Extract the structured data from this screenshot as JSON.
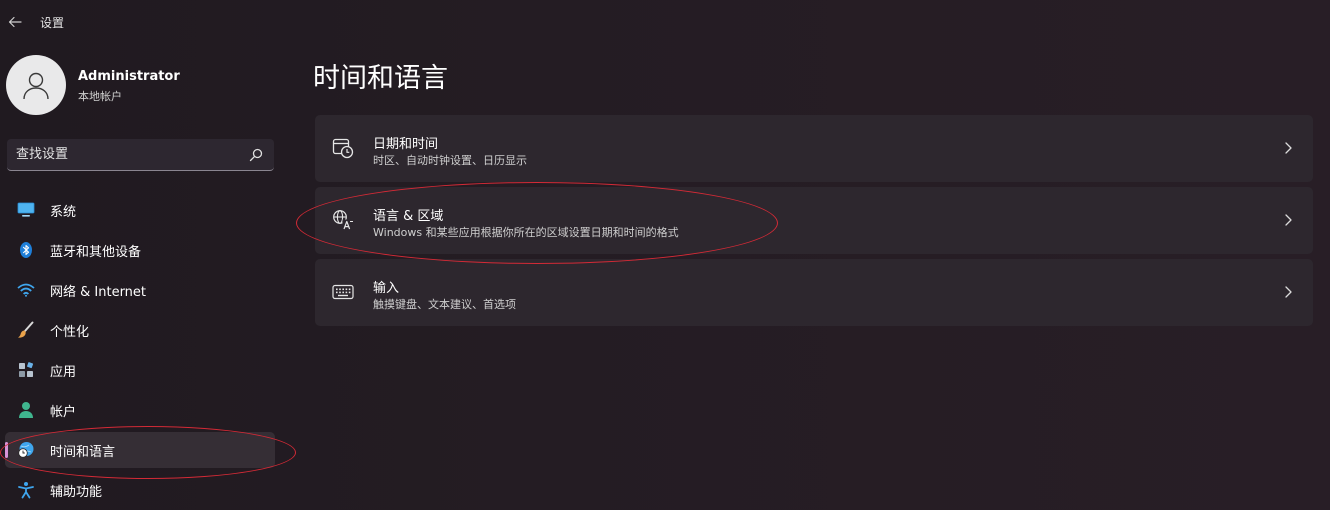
{
  "window": {
    "title": "设置"
  },
  "profile": {
    "name": "Administrator",
    "account_type": "本地帐户"
  },
  "search": {
    "placeholder": "查找设置",
    "value": ""
  },
  "sidebar": {
    "items": [
      {
        "label": "系统",
        "icon": "monitor-icon",
        "active": false
      },
      {
        "label": "蓝牙和其他设备",
        "icon": "bluetooth-icon",
        "active": false
      },
      {
        "label": "网络 & Internet",
        "icon": "wifi-icon",
        "active": false
      },
      {
        "label": "个性化",
        "icon": "brush-icon",
        "active": false
      },
      {
        "label": "应用",
        "icon": "apps-icon",
        "active": false
      },
      {
        "label": "帐户",
        "icon": "person-icon",
        "active": false
      },
      {
        "label": "时间和语言",
        "icon": "globe-clock-icon",
        "active": true
      },
      {
        "label": "辅助功能",
        "icon": "accessibility-icon",
        "active": false
      }
    ]
  },
  "main": {
    "title": "时间和语言",
    "cards": [
      {
        "title": "日期和时间",
        "subtitle": "时区、自动时钟设置、日历显示",
        "icon": "calendar-clock-icon"
      },
      {
        "title": "语言 & 区域",
        "subtitle": "Windows 和某些应用根据你所在的区域设置日期和时间的格式",
        "icon": "language-icon"
      },
      {
        "title": "输入",
        "subtitle": "触摸键盘、文本建议、首选项",
        "icon": "keyboard-icon"
      }
    ]
  },
  "colors": {
    "background": "#231c22",
    "card": "#2d272e",
    "active_nav": "#352e35",
    "accent_indicator": "#d894d8",
    "annotation_ring": "#d32a36"
  }
}
